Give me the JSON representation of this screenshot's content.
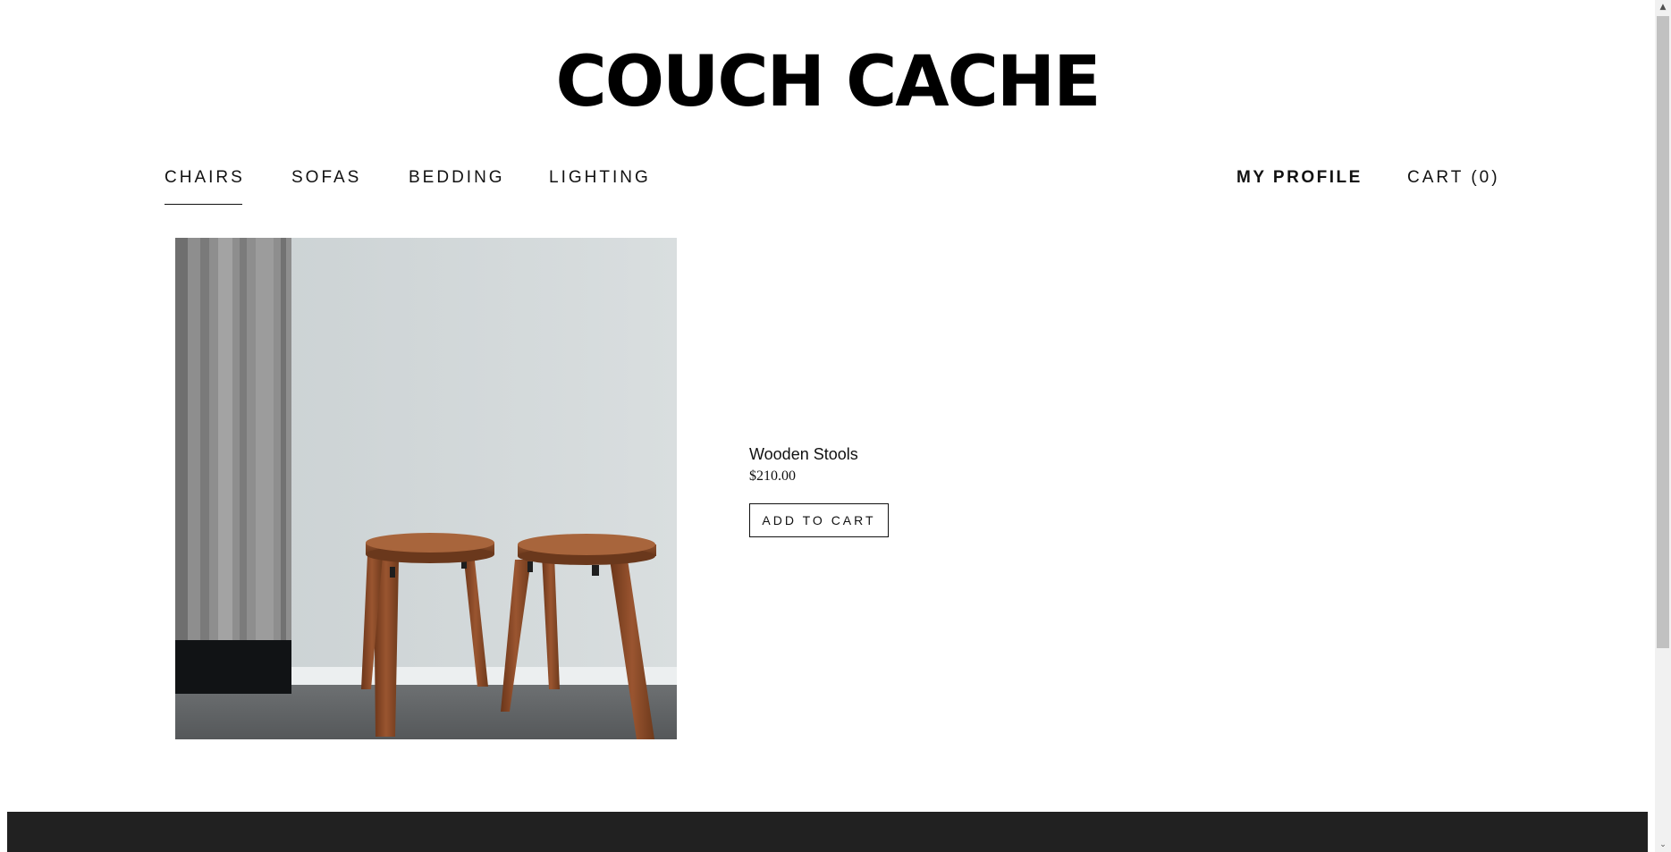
{
  "brand": {
    "name": "COUCH CACHE"
  },
  "nav": {
    "categories": [
      {
        "label": "CHAIRS",
        "active": true
      },
      {
        "label": "SOFAS",
        "active": false
      },
      {
        "label": "BEDDING",
        "active": false
      },
      {
        "label": "LIGHTING",
        "active": false
      }
    ],
    "profile_label": "MY PROFILE",
    "cart_label": "CART (0)"
  },
  "product": {
    "name": "Wooden Stools",
    "price": "$210.00",
    "add_to_cart_label": "ADD TO CART"
  },
  "scrollbar": {
    "up_icon": "triangle-up",
    "down_icon": "chevron-down"
  },
  "colors": {
    "footer": "#212121",
    "wall": "#d3d9da",
    "wood": "#8a4b2a",
    "curtain": "#8e8e8e"
  }
}
